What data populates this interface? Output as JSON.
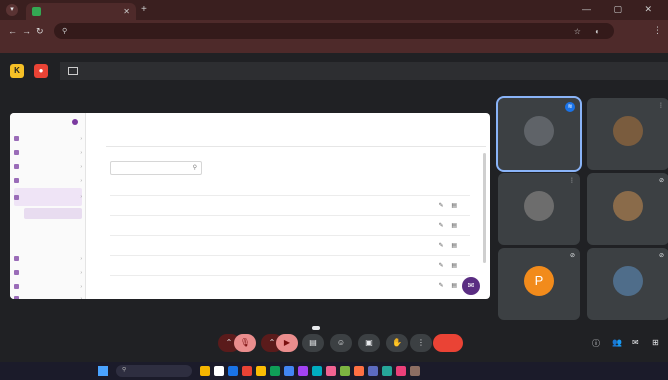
{
  "browser": {
    "tab_title": "",
    "url": ""
  },
  "presenting_banner": "",
  "shared_app": {
    "brand": "",
    "sidebar": [],
    "tabs": [],
    "search_placeholder": "",
    "columns": [
      "",
      ""
    ],
    "rows": []
  },
  "participants": [
    {
      "name": "",
      "avatar_color": "#5f6368"
    },
    {
      "name": "",
      "avatar_color": "#7a5c3e"
    },
    {
      "name": "",
      "avatar_color": "#6d6d6d"
    },
    {
      "name": "",
      "avatar_color": "#8a6b4a"
    },
    {
      "name": "",
      "avatar_letter": "P",
      "avatar_color": "#f28b1b"
    },
    {
      "name": "",
      "avatar_color": "#4f6d8a"
    }
  ],
  "controls": {
    "room_name": "",
    "tooltip": "",
    "end_label": ""
  },
  "colors": {
    "brand": "#5a2d82",
    "end_call": "#ea4335",
    "active_speaker": "#8ab4f8"
  }
}
